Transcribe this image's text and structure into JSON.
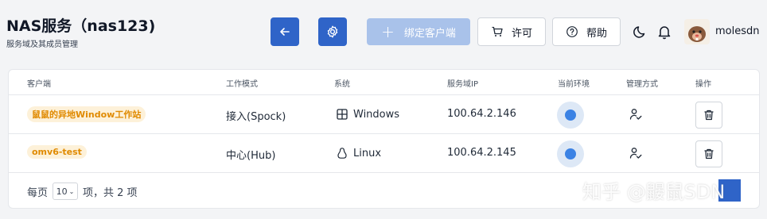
{
  "header": {
    "title": "NAS服务（nas123)",
    "subtitle": "服务域及其成员管理"
  },
  "toolbar": {
    "add_client_label": "绑定客户端",
    "license_label": "许可",
    "help_label": "帮助"
  },
  "user": {
    "name": "molesdn"
  },
  "table": {
    "columns": [
      "客户端",
      "工作模式",
      "系统",
      "服务域IP",
      "当前环境",
      "管理方式",
      "操作"
    ],
    "rows": [
      {
        "client": "鼠鼠的异地Window工作站",
        "mode": "接入(Spock)",
        "os": "Windows",
        "ip": "100.64.2.146"
      },
      {
        "client": "omv6-test",
        "mode": "中心(Hub)",
        "os": "Linux",
        "ip": "100.64.2.145"
      }
    ]
  },
  "pagination": {
    "per_page_prefix": "每页",
    "page_size": "10",
    "suffix": "项，共 2 项"
  },
  "watermark": "知乎 @鼹鼠SDN",
  "colors": {
    "primary": "#2f64c8",
    "primary_disabled": "#a9c2ea",
    "tag_bg": "#fdf1d9",
    "tag_text": "#e08a00",
    "status_dot": "#3b82e4"
  }
}
